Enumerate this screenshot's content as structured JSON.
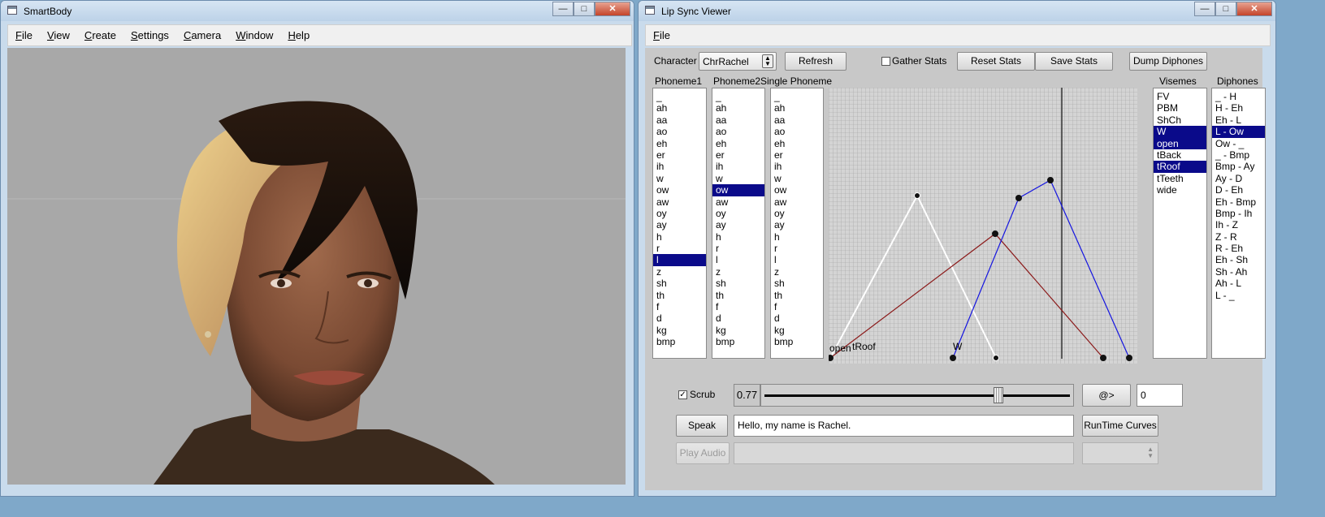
{
  "smartbody": {
    "title": "SmartBody",
    "menus": [
      "File",
      "View",
      "Create",
      "Settings",
      "Camera",
      "Window",
      "Help"
    ]
  },
  "lipsync": {
    "title": "Lip Sync Viewer",
    "menus": [
      "File"
    ],
    "character_label": "Character",
    "character_value": "ChrRachel",
    "refresh_label": "Refresh",
    "gather_stats_label": "Gather Stats",
    "gather_stats_checked": false,
    "reset_stats_label": "Reset Stats",
    "save_stats_label": "Save Stats",
    "dump_diphones_label": "Dump Diphones",
    "phoneme1_label": "Phoneme1",
    "phoneme2_label": "Phoneme2",
    "single_phoneme_label": "Single Phoneme",
    "visemes_label": "Visemes",
    "diphones_label": "Diphones",
    "phonemes": [
      "_",
      "ah",
      "aa",
      "ao",
      "eh",
      "er",
      "ih",
      "w",
      "ow",
      "aw",
      "oy",
      "ay",
      "h",
      "r",
      "l",
      "z",
      "sh",
      "th",
      "f",
      "d",
      "kg",
      "bmp"
    ],
    "phoneme1_selected": "l",
    "phoneme2_selected": "ow",
    "visemes": [
      "FV",
      "PBM",
      "ShCh",
      "W",
      "open",
      "tBack",
      "tRoof",
      "tTeeth",
      "wide"
    ],
    "visemes_selected": [
      "W",
      "open",
      "tRoof"
    ],
    "diphones": [
      "_ - H",
      "H - Eh",
      "Eh - L",
      "L - Ow",
      "Ow - _",
      "_ - Bmp",
      "Bmp - Ay",
      "Ay - D",
      "D - Eh",
      "Eh - Bmp",
      "Bmp - Ih",
      "Ih - Z",
      "Z - R",
      "R - Eh",
      "Eh - Sh",
      "Sh - Ah",
      "Ah - L",
      "L - _"
    ],
    "diphones_selected": "L - Ow",
    "curve_labels": [
      "open",
      "tRoof",
      "W"
    ],
    "scrub_label": "Scrub",
    "scrub_checked": true,
    "scrub_value": "0.77",
    "scrub_fraction": 0.77,
    "goto_label": "@>",
    "goto_value": "0",
    "speak_label": "Speak",
    "speak_text": "Hello, my name is Rachel.",
    "runtime_curves_label": "RunTime Curves",
    "play_audio_label": "Play Audio"
  }
}
